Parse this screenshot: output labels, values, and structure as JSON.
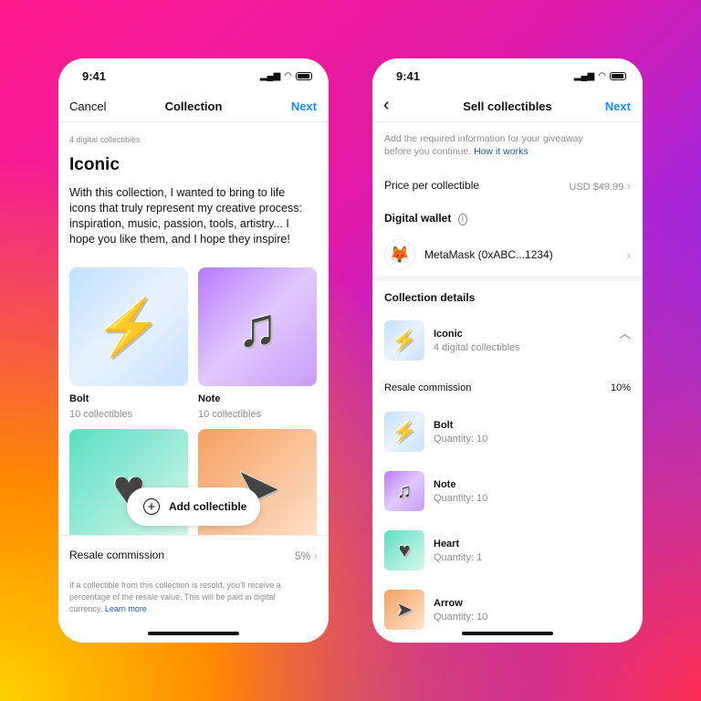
{
  "status": {
    "time": "9:41"
  },
  "left": {
    "nav": {
      "cancel": "Cancel",
      "title": "Collection",
      "next": "Next"
    },
    "count": "4 digital collectibles",
    "title": "Iconic",
    "description": "With this collection, I wanted to bring to life icons that truly represent my creative process: inspiration, music, passion, tools, artistry... I hope you like them, and I hope they inspire!",
    "items": [
      {
        "name": "Bolt",
        "sub": "10 collectibles",
        "icon": "bolt-icon"
      },
      {
        "name": "Note",
        "sub": "10 collectibles",
        "icon": "music-note-icon"
      },
      {
        "name": "Heart",
        "icon": "heart-icon"
      },
      {
        "name": "Arrow",
        "icon": "cursor-arrow-icon"
      }
    ],
    "add_button": "Add collectible",
    "resale": {
      "label": "Resale commission",
      "value": "5%"
    },
    "footnote": "If a collectible from this collection is resold, you'll receive a percentage of the resale value. This will be paid in digital currency.",
    "learn_more": "Learn more"
  },
  "right": {
    "nav": {
      "title": "Sell collectibles",
      "next": "Next"
    },
    "intro": "Add the required information for your giveaway before you continue.",
    "how_it_works": "How it works",
    "price": {
      "label": "Price per collectible",
      "value": "USD $49.99"
    },
    "wallet_heading": "Digital wallet",
    "wallet": "MetaMask (0xABC...1234)",
    "details_heading": "Collection details",
    "collection": {
      "name": "Iconic",
      "sub": "4 digital collectibles"
    },
    "resale": {
      "label": "Resale commission",
      "value": "10%"
    },
    "items": [
      {
        "name": "Bolt",
        "qty": "Quantity: 10"
      },
      {
        "name": "Note",
        "qty": "Quantity: 10"
      },
      {
        "name": "Heart",
        "qty": "Quantity: 1"
      },
      {
        "name": "Arrow",
        "qty": "Quantity: 10"
      }
    ]
  },
  "colors": {
    "accent": "#1a8cff",
    "link": "#1c5a9c"
  }
}
